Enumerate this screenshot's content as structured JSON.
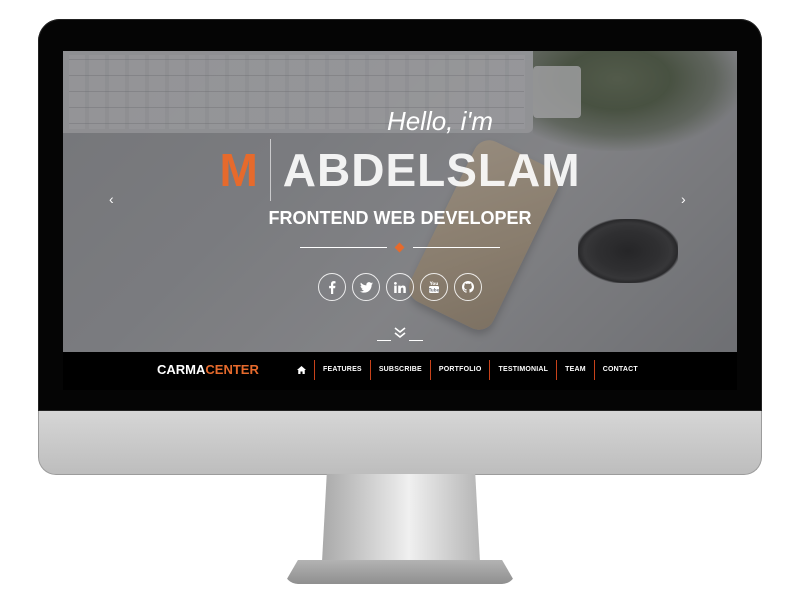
{
  "hero": {
    "greeting": "Hello, i'm",
    "initial": "M",
    "surname": "ABDELSLAM",
    "role": "FRONTEND WEB DEVELOPER",
    "accent_color": "#e66a2c",
    "socials": [
      {
        "icon": "facebook-icon",
        "glyph": "f"
      },
      {
        "icon": "twitter-icon",
        "glyph": "t"
      },
      {
        "icon": "linkedin-icon",
        "glyph": "in"
      },
      {
        "icon": "youtube-icon",
        "glyph": "You"
      },
      {
        "icon": "github-icon",
        "glyph": "gh"
      }
    ],
    "prev_arrow": "‹",
    "next_arrow": "›"
  },
  "navbar": {
    "brand_primary": "CARMA",
    "brand_accent": "CENTER",
    "home_icon": "home-icon",
    "items": [
      "FEATURES",
      "SUBSCRIBE",
      "PORTFOLIO",
      "TESTIMONIAL",
      "TEAM",
      "CONTACT"
    ]
  }
}
